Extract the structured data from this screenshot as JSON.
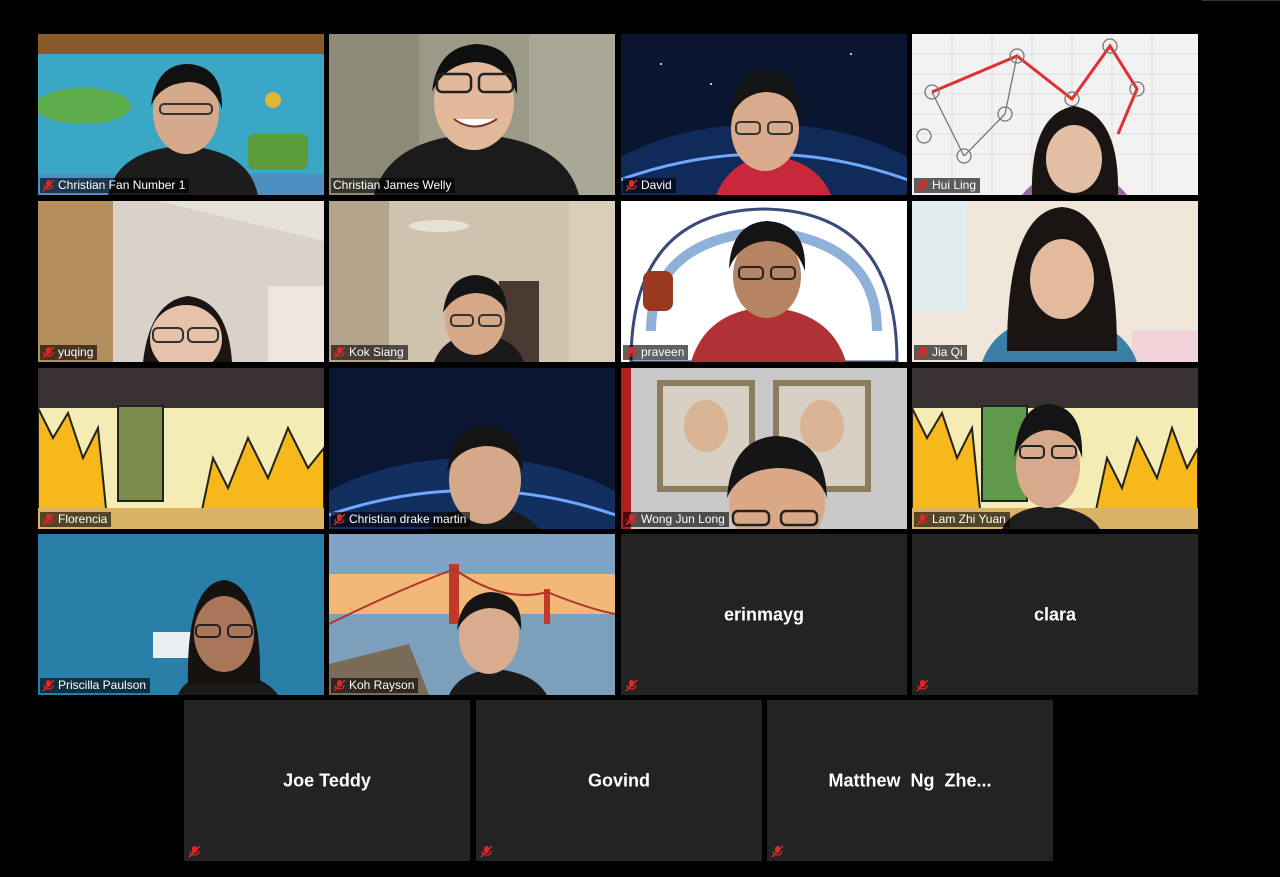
{
  "participants": [
    {
      "name": "Christian Fan Number 1",
      "video": true,
      "muted": true,
      "scene": "spongebob"
    },
    {
      "name": "Christian James Welly",
      "video": true,
      "muted": false,
      "active_speaker": true,
      "scene": "room"
    },
    {
      "name": "David",
      "video": true,
      "muted": true,
      "scene": "earth"
    },
    {
      "name": "Hui Ling",
      "video": true,
      "muted": true,
      "scene": "graph"
    },
    {
      "name": "yuqing",
      "video": true,
      "muted": true,
      "scene": "bedroom"
    },
    {
      "name": "Kok Siang",
      "video": true,
      "muted": true,
      "scene": "room2"
    },
    {
      "name": "praveen",
      "video": true,
      "muted": true,
      "scene": "igloo"
    },
    {
      "name": "Jia Qi",
      "video": true,
      "muted": true,
      "scene": "plainroom"
    },
    {
      "name": "Florencia",
      "video": true,
      "muted": true,
      "scene": "fire"
    },
    {
      "name": "Christian drake martin",
      "video": true,
      "muted": true,
      "scene": "earth"
    },
    {
      "name": "Wong Jun Long",
      "video": true,
      "muted": true,
      "scene": "portraits"
    },
    {
      "name": "Lam Zhi Yuan",
      "video": true,
      "muted": true,
      "scene": "fire"
    },
    {
      "name": "Priscilla Paulson",
      "video": true,
      "muted": true,
      "scene": "bluewall"
    },
    {
      "name": "Koh Rayson",
      "video": true,
      "muted": true,
      "scene": "bridge"
    },
    {
      "name": "erinmayg",
      "video": false,
      "muted": true
    },
    {
      "name": "clara",
      "video": false,
      "muted": true
    },
    {
      "name": "Joe Teddy",
      "video": false,
      "muted": true
    },
    {
      "name": "Govind",
      "video": false,
      "muted": true
    },
    {
      "name": "Matthew  Ng  Zhe...",
      "video": false,
      "muted": true
    }
  ],
  "icons": {
    "muted": "muted-mic-icon"
  },
  "colors": {
    "active_speaker_border": "#c7e66a",
    "tile_background": "#232323",
    "muted_icon": "#e02828"
  }
}
